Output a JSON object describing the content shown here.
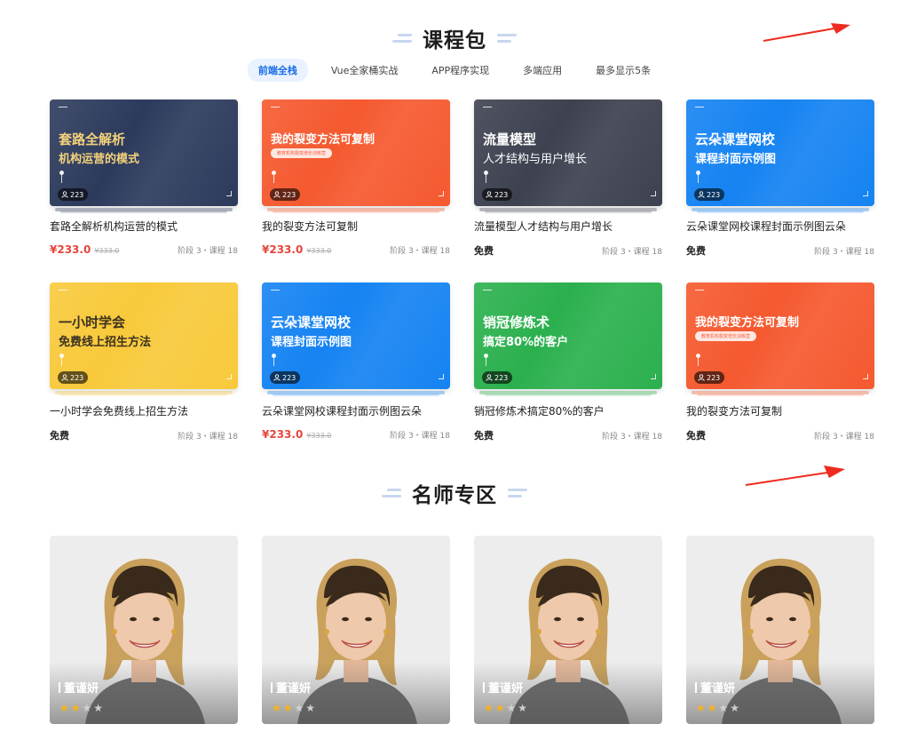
{
  "sections": {
    "courses_title": "课程包",
    "teachers_title": "名师专区"
  },
  "tabs": [
    {
      "label": "前端全栈",
      "active": true
    },
    {
      "label": "Vue全家桶实战",
      "active": false
    },
    {
      "label": "APP程序实现",
      "active": false
    },
    {
      "label": "多端应用",
      "active": false
    },
    {
      "label": "最多显示5条",
      "active": false
    }
  ],
  "courses": [
    {
      "title": "套路全解析机构运营的模式",
      "cover_line1": "套路全解析",
      "cover_line2": "机构运营的模式",
      "cover_style": "navy",
      "price": "¥233.0",
      "old_price": "¥333.0",
      "free": "",
      "stats": "阶段 3・课程 18",
      "students": "223"
    },
    {
      "title": "我的裂变方法可复制",
      "cover_line1": "我的裂变方法可复制",
      "cover_pill": "教育机构裂变增长训练营",
      "cover_style": "orange",
      "price": "¥233.0",
      "old_price": "¥333.0",
      "free": "",
      "stats": "阶段 3・课程 18",
      "students": "223"
    },
    {
      "title": "流量模型人才结构与用户增长",
      "cover_line1": "流量模型",
      "cover_line2": "人才结构与用户增长",
      "cover_style": "gray",
      "price": "",
      "old_price": "",
      "free": "免费",
      "stats": "阶段 3・课程 18",
      "students": "223"
    },
    {
      "title": "云朵课堂网校课程封面示例图云朵",
      "cover_line1": "云朵课堂网校",
      "cover_line2": "课程封面示例图",
      "cover_style": "blue",
      "price": "",
      "old_price": "",
      "free": "免费",
      "stats": "阶段 3・课程 18",
      "students": "223"
    },
    {
      "title": "一小时学会免费线上招生方法",
      "cover_line1": "一小时学会",
      "cover_line2": "免费线上招生方法",
      "cover_style": "yellow",
      "price": "",
      "old_price": "",
      "free": "免费",
      "stats": "阶段 3・课程 18",
      "students": "223"
    },
    {
      "title": "云朵课堂网校课程封面示例图云朵",
      "cover_line1": "云朵课堂网校",
      "cover_line2": "课程封面示例图",
      "cover_style": "blue",
      "price": "¥233.0",
      "old_price": "¥333.0",
      "free": "",
      "stats": "阶段 3・课程 18",
      "students": "223"
    },
    {
      "title": "销冠修炼术搞定80%的客户",
      "cover_line1": "销冠修炼术",
      "cover_line2": "搞定80%的客户",
      "cover_style": "green",
      "price": "",
      "old_price": "",
      "free": "免费",
      "stats": "阶段 3・课程 18",
      "students": "223"
    },
    {
      "title": "我的裂变方法可复制",
      "cover_line1": "我的裂变方法可复制",
      "cover_pill": "教育机构裂变增长训练营",
      "cover_style": "orange",
      "price": "",
      "old_price": "",
      "free": "免费",
      "stats": "阶段 3・课程 18",
      "students": "223"
    }
  ],
  "teachers": [
    {
      "name": "董谨妍",
      "rating": 2,
      "max_rating": 4
    },
    {
      "name": "董谨妍",
      "rating": 2,
      "max_rating": 4
    },
    {
      "name": "董谨妍",
      "rating": 2,
      "max_rating": 4
    },
    {
      "name": "董谨妍",
      "rating": 2,
      "max_rating": 4
    }
  ],
  "cover_styles": {
    "navy": {
      "bg": "#2c3a5c",
      "title": "#f3d27a"
    },
    "orange": {
      "bg": "#f5592f",
      "title": "#ffffff"
    },
    "gray": {
      "bg": "#3d4150",
      "title": "#ffffff"
    },
    "blue": {
      "bg": "#1583f2",
      "title": "#ffffff"
    },
    "yellow": {
      "bg": "#f8c93a",
      "title": "#3b3120"
    },
    "green": {
      "bg": "#2bb04e",
      "title": "#ffffff"
    }
  },
  "colors": {
    "accent": "#1a6ce8",
    "price": "#e5473d",
    "arrow": "#ee2b1f",
    "star_on": "#f6b21a",
    "star_off": "#d0d0d0"
  },
  "icons": {
    "student": "user-icon",
    "star": "star-icon",
    "arrow": "red-arrow-icon"
  }
}
